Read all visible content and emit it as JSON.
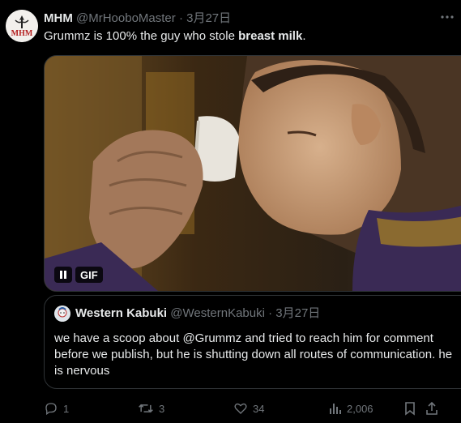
{
  "tweet": {
    "author_name": "MHM",
    "handle": "@MrHooboMaster",
    "separator": "·",
    "date": "3月27日",
    "text_prefix": "Grummz is 100% the guy who stole ",
    "text_bold": "breast milk",
    "text_suffix": ".",
    "avatar_letters": "MHM",
    "more_icon": "more-horizontal-icon"
  },
  "media": {
    "gif_label": "GIF",
    "pause_icon": "pause-icon"
  },
  "quote": {
    "author_name": "Western Kabuki",
    "handle": "@WesternKabuki",
    "separator": "·",
    "date": "3月27日",
    "text": "we have a scoop about @Grummz and tried to reach him for comment before we publish, but he is shutting down all routes of communication. he is nervous"
  },
  "actions": {
    "replies": "1",
    "reposts": "3",
    "likes": "34",
    "views": "2,006"
  },
  "colors": {
    "background": "#000000",
    "text": "#e7e9ea",
    "muted": "#71767b",
    "border": "#2f3336"
  }
}
